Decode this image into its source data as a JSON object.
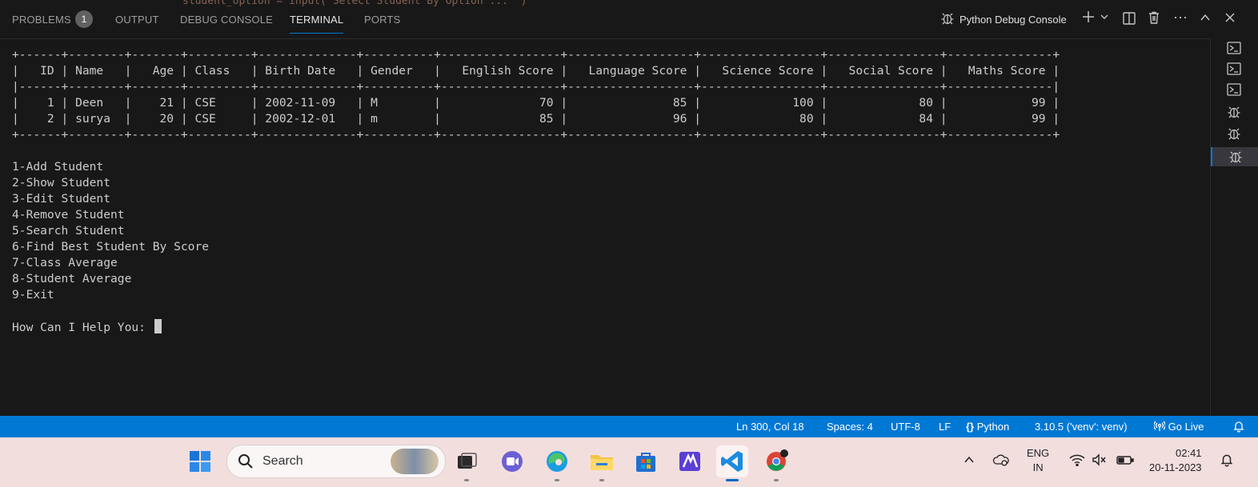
{
  "panel": {
    "tabs": [
      {
        "label": "PROBLEMS",
        "badge": "1"
      },
      {
        "label": "OUTPUT"
      },
      {
        "label": "DEBUG CONSOLE"
      },
      {
        "label": "TERMINAL",
        "active": true
      },
      {
        "label": "PORTS"
      }
    ],
    "code_peek": "student_option = input(\"Select Student By Option ... \")",
    "terminal_name": "Python Debug Console",
    "icons": [
      "debug-icon",
      "plus-icon",
      "chevron-down-icon",
      "split-icon",
      "trash-icon",
      "ellipsis-icon",
      "chevron-up-icon",
      "close-icon"
    ]
  },
  "terminal": {
    "table_border": "+------+--------+-------+---------+--------------+----------+-----------------+------------------+-----------------+----------------+---------------+",
    "table_header": "|   ID | Name   |   Age | Class   | Birth Date   | Gender   |   English Score |   Language Score |   Science Score |   Social Score |   Maths Score |",
    "table_header_sep": "|------+--------+-------+---------+--------------+----------+-----------------+------------------+-----------------+----------------+---------------|",
    "table_rows": [
      "|    1 | Deen   |    21 | CSE     | 2002-11-09   | M        |              70 |               85 |             100 |             80 |            99 |",
      "|    2 | surya  |    20 | CSE     | 2002-12-01   | m        |              85 |               96 |              80 |             84 |            99 |"
    ],
    "menu": [
      "1-Add Student",
      "2-Show Student",
      "3-Edit Student",
      "4-Remove Student",
      "5-Search Student",
      "6-Find Best Student By Score",
      "7-Class Average",
      "8-Student Average",
      "9-Exit"
    ],
    "prompt": "How Can I Help You: "
  },
  "terminal_list": [
    {
      "icon": "terminal-icon"
    },
    {
      "icon": "terminal-icon"
    },
    {
      "icon": "terminal-icon"
    },
    {
      "icon": "debug-icon"
    },
    {
      "icon": "debug-icon"
    },
    {
      "icon": "debug-icon",
      "active": true
    }
  ],
  "statusbar": {
    "position": "Ln 300, Col 18",
    "spaces": "Spaces: 4",
    "encoding": "UTF-8",
    "eol": "LF",
    "language": "Python",
    "interpreter": "3.10.5 ('venv': venv)",
    "golive": "Go Live"
  },
  "taskbar": {
    "search_placeholder": "Search",
    "apps": [
      "windows-start",
      "task-view",
      "teams-chat",
      "edge",
      "file-explorer",
      "microsoft-store",
      "visual-studio",
      "vscode",
      "chrome"
    ],
    "active_app": "vscode",
    "lang_top": "ENG",
    "lang_bottom": "IN",
    "time": "02:41",
    "date": "20-11-2023"
  },
  "colors": {
    "accent": "#0078d4",
    "terminal_bg": "#181818",
    "terminal_text": "#cccccc",
    "taskbar_bg": "#f3dede"
  }
}
